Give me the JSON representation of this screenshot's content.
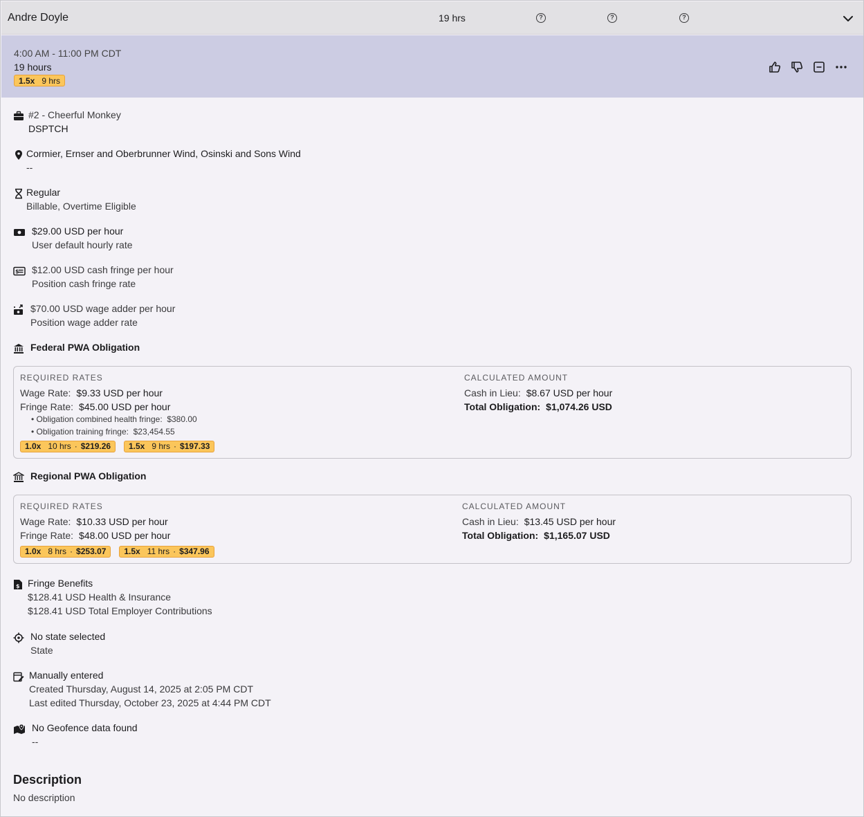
{
  "header": {
    "employee_name": "Andre Doyle",
    "total_hours": "19 hrs"
  },
  "shift": {
    "time_range": "4:00 AM - 11:00 PM CDT",
    "hours": "19 hours",
    "overtime_chip": {
      "multiplier": "1.5x",
      "hours": "9 hrs"
    }
  },
  "details": {
    "job": {
      "title": "#2 - Cheerful Monkey",
      "code": "DSPTCH"
    },
    "location": {
      "name": "Cormier, Ernser and Oberbrunner Wind, Osinski and Sons Wind",
      "detail": "--"
    },
    "type": {
      "name": "Regular",
      "detail": "Billable, Overtime Eligible"
    },
    "rate": {
      "value": "$29.00 USD per hour",
      "detail": "User default hourly rate"
    },
    "cash_fringe": {
      "value": "$12.00 USD cash fringe per hour",
      "detail": "Position cash fringe rate"
    },
    "wage_adder": {
      "value": "$70.00 USD wage adder per hour",
      "detail": "Position wage adder rate"
    }
  },
  "federal": {
    "title": "Federal PWA Obligation",
    "required_caption": "REQUIRED RATES",
    "calculated_caption": "CALCULATED AMOUNT",
    "wage_label": "Wage Rate:",
    "wage_value": "$9.33 USD per hour",
    "fringe_label": "Fringe Rate:",
    "fringe_value": "$45.00 USD per hour",
    "sub_items": [
      {
        "label": "• Obligation combined health fringe:",
        "value": "$380.00"
      },
      {
        "label": "• Obligation training fringe:",
        "value": "$23,454.55"
      }
    ],
    "chips": [
      {
        "multiplier": "1.0x",
        "hours": "10 hrs",
        "amount": "$219.26"
      },
      {
        "multiplier": "1.5x",
        "hours": "9 hrs",
        "amount": "$197.33"
      }
    ],
    "cash_label": "Cash in Lieu:",
    "cash_value": "$8.67 USD per hour",
    "total_label": "Total Obligation:",
    "total_value": "$1,074.26 USD"
  },
  "regional": {
    "title": "Regional PWA Obligation",
    "required_caption": "REQUIRED RATES",
    "calculated_caption": "CALCULATED AMOUNT",
    "wage_label": "Wage Rate:",
    "wage_value": "$10.33 USD per hour",
    "fringe_label": "Fringe Rate:",
    "fringe_value": "$48.00 USD per hour",
    "chips": [
      {
        "multiplier": "1.0x",
        "hours": "8 hrs",
        "amount": "$253.07"
      },
      {
        "multiplier": "1.5x",
        "hours": "11 hrs",
        "amount": "$347.96"
      }
    ],
    "cash_label": "Cash in Lieu:",
    "cash_value": "$13.45 USD per hour",
    "total_label": "Total Obligation:",
    "total_value": "$1,165.07 USD"
  },
  "fringe_benefits": {
    "title": "Fringe Benefits",
    "health": "$128.41 USD Health & Insurance",
    "total": "$128.41 USD Total Employer Contributions"
  },
  "state": {
    "value": "No state selected",
    "label": "State"
  },
  "entry": {
    "method": "Manually entered",
    "created": "Created Thursday, August 14, 2025 at 2:05 PM CDT",
    "edited": "Last edited Thursday, October 23, 2025 at 4:44 PM CDT"
  },
  "geofence": {
    "value": "No Geofence data found",
    "detail": "--"
  },
  "description": {
    "heading": "Description",
    "text": "No description"
  },
  "icons": [
    "help-icon",
    "chevron-down-icon",
    "thumbs-up-icon",
    "thumbs-down-icon",
    "minus-square-icon",
    "more-icon",
    "briefcase-icon",
    "location-pin-icon",
    "hourglass-icon",
    "cash-icon",
    "fringe-card-icon",
    "wage-adder-icon",
    "bank-icon",
    "document-dollar-icon",
    "crosshair-icon",
    "edit-calendar-icon",
    "map-icon"
  ]
}
